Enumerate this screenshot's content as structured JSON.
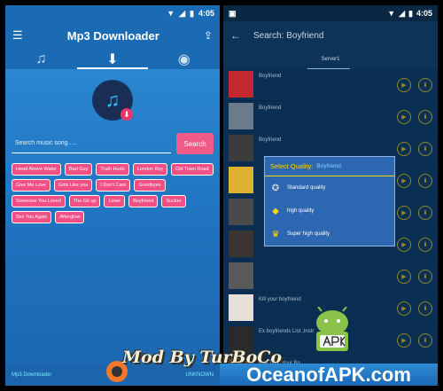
{
  "left": {
    "status": {
      "time": "4:05"
    },
    "title": "Mp3 Downloader",
    "search": {
      "placeholder": "Search music song.....",
      "button": "Search"
    },
    "chips": [
      "Head Above Water",
      "Bad Guy",
      "Truth Hurts",
      "London Boy",
      "Old Town Road",
      "Give Me Love",
      "Girls Like you",
      "I Don't Care",
      "Goodbyes",
      "Someone You Loved",
      "The Git up",
      "Lover",
      "Boyfriend",
      "Sucker",
      "Sex You Again",
      "Afterglow"
    ],
    "bottom": {
      "left": "Mp3 Downloader",
      "right": "UNKNOWN"
    }
  },
  "right": {
    "status": {
      "time": "4:05"
    },
    "title": "Search: Boyfriend",
    "server": "Server1",
    "results": [
      "Boyfriend",
      "Boyfriend",
      "Boyfriend",
      "",
      "",
      "",
      "",
      "Kill your boyfriend",
      "Ex boyfriends List ,Instr",
      "Ima Take Your Bo"
    ],
    "modal": {
      "title": "Select Quality:",
      "query": "Boyfriend",
      "options": [
        "Standard quality",
        "high quality",
        "Super high quality"
      ]
    }
  },
  "watermark": "Mod By TurBoCo",
  "brand": "OceanofAPK.com",
  "colors": {
    "accent_pink": "#f15b87",
    "left_bg": "#2f8fd8",
    "right_bg": "#0b2f52",
    "modal_title": "#ffd600"
  }
}
